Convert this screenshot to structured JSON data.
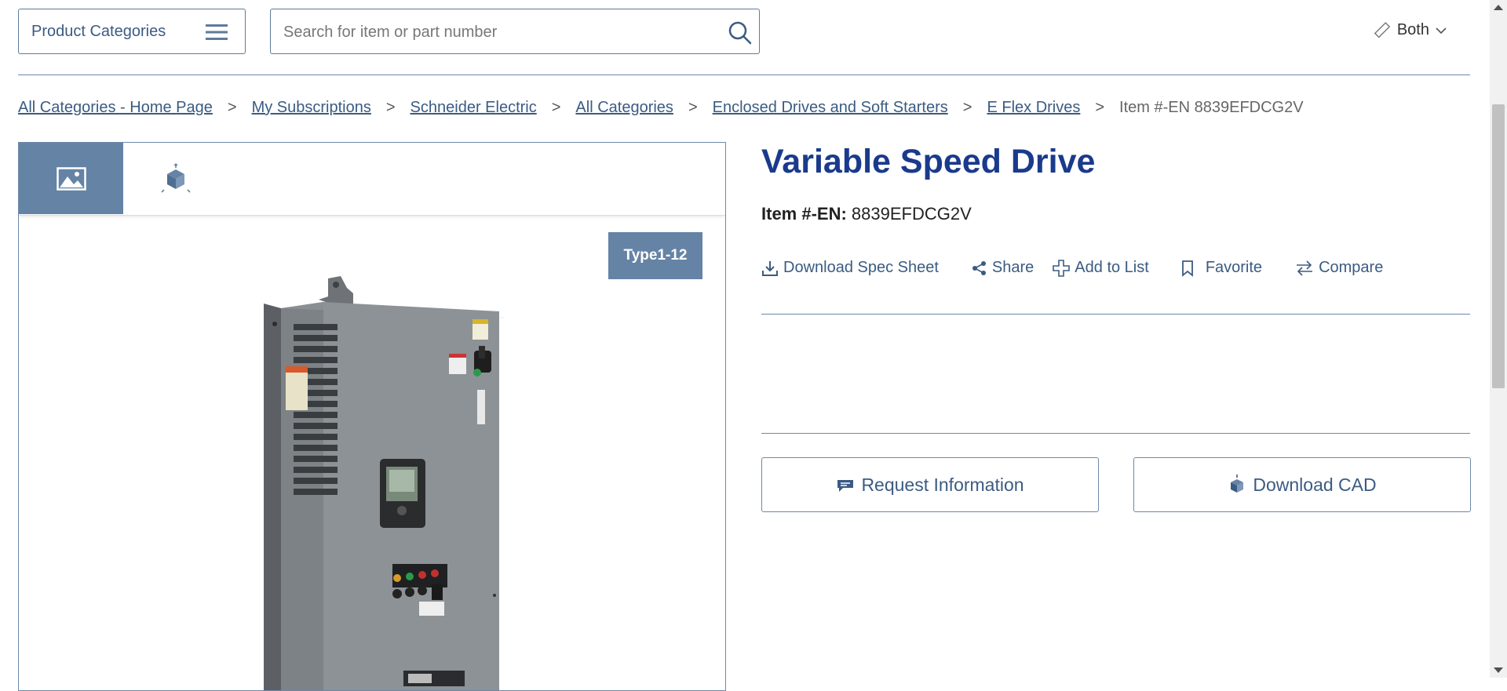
{
  "header": {
    "categories_label": "Product Categories",
    "search_placeholder": "Search for item or part number",
    "units_label": "Both"
  },
  "breadcrumb": {
    "links": [
      "All Categories - Home Page",
      "My Subscriptions",
      "Schneider Electric",
      "All Categories",
      "Enclosed Drives and Soft Starters",
      "E Flex Drives"
    ],
    "separator": ">",
    "current": "Item #-EN 8839EFDCG2V"
  },
  "gallery": {
    "tabs": [
      {
        "icon": "image-icon",
        "active": true
      },
      {
        "icon": "3d-cube-icon",
        "active": false
      }
    ],
    "badge": "Type1-12"
  },
  "product": {
    "title": "Variable Speed Drive",
    "item_key": "Item #-EN:",
    "item_value": "8839EFDCG2V"
  },
  "actions": {
    "download_spec": "Download Spec Sheet",
    "share": "Share",
    "add_to_list": "Add to List",
    "favorite": "Favorite",
    "compare": "Compare"
  },
  "buttons": {
    "request_info": "Request Information",
    "download_cad": "Download CAD"
  },
  "colors": {
    "accent": "#6583a5",
    "link": "#3b5b82",
    "title": "#1a3a8c"
  }
}
